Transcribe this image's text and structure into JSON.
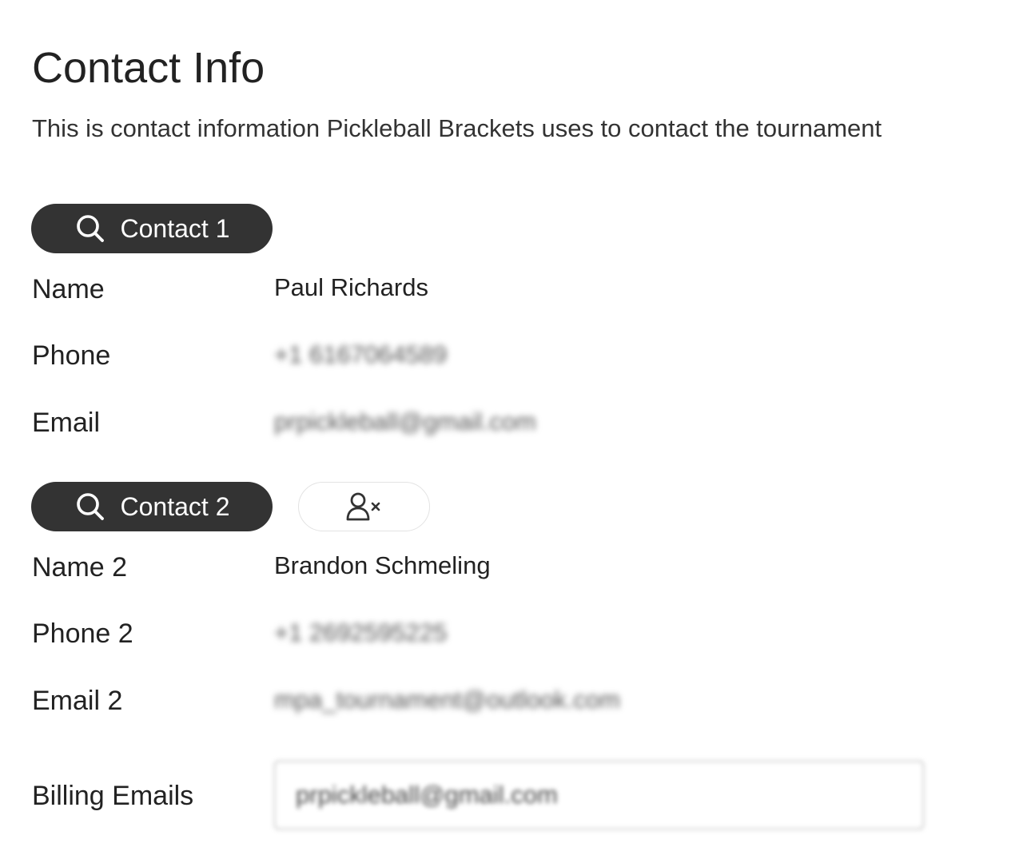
{
  "header": {
    "title": "Contact Info",
    "subtitle": "This is contact information Pickleball Brackets uses to contact the tournament"
  },
  "contact1": {
    "button_label": "Contact 1",
    "button_icon": "search-icon",
    "name_label": "Name",
    "name_value": "Paul Richards",
    "phone_label": "Phone",
    "phone_value": "+1 6167064589",
    "email_label": "Email",
    "email_value": "prpickleball@gmail.com"
  },
  "contact2": {
    "button_label": "Contact 2",
    "button_icon": "search-icon",
    "remove_icon": "remove-user-icon",
    "name_label": "Name 2",
    "name_value": "Brandon Schmeling",
    "phone_label": "Phone 2",
    "phone_value": "+1 2692595225",
    "email_label": "Email 2",
    "email_value": "mpa_tournament@outlook.com"
  },
  "billing": {
    "label": "Billing Emails",
    "value": "prpickleball@gmail.com"
  },
  "colors": {
    "pill_background": "#333333",
    "pill_text": "#ffffff",
    "text": "#222222",
    "input_border": "#9a9a9a"
  }
}
